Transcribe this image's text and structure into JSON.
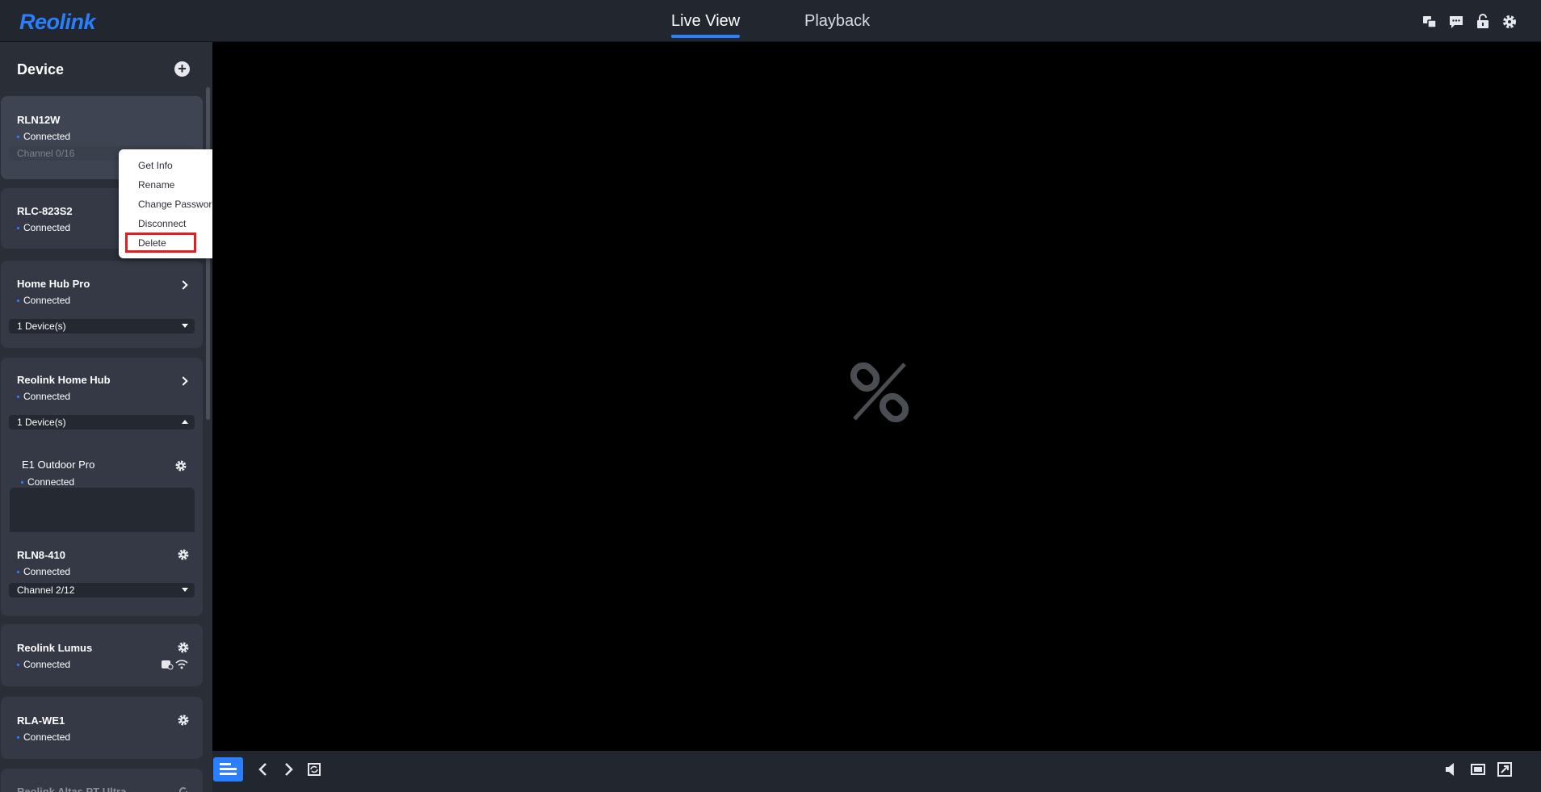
{
  "app": {
    "logo": "Reolink"
  },
  "header": {
    "tabs": [
      {
        "label": "Live View",
        "active": true
      },
      {
        "label": "Playback",
        "active": false
      }
    ],
    "icons": [
      "translate-icon",
      "message-icon",
      "lock-icon",
      "settings-icon"
    ]
  },
  "sidebar": {
    "title": "Device",
    "devices": [
      {
        "name": "RLN12W",
        "status": "Connected",
        "sub": "Channel 0/16"
      },
      {
        "name": "RLC-823S2",
        "status": "Connected"
      },
      {
        "name": "Home Hub Pro",
        "status": "Connected",
        "sub": "1 Device(s)"
      },
      {
        "name": "Reolink Home Hub",
        "status": "Connected",
        "sub": "1 Device(s)",
        "children": [
          {
            "name": "E1 Outdoor Pro",
            "status": "Connected"
          }
        ]
      },
      {
        "name": "RLN8-410",
        "status": "Connected",
        "sub": "Channel 2/12"
      },
      {
        "name": "Reolink Lumus",
        "status": "Connected"
      },
      {
        "name": "RLA-WE1",
        "status": "Connected"
      },
      {
        "name": "Reolink Altas PT Ultra"
      }
    ]
  },
  "context_menu": {
    "items": [
      "Get Info",
      "Rename",
      "Change Password",
      "Disconnect",
      "Delete"
    ],
    "highlighted": "Delete",
    "highlight_color": "#e0201f"
  },
  "colors": {
    "accent": "#2a7fff",
    "background": "#000000",
    "panel": "#2a2e37"
  }
}
